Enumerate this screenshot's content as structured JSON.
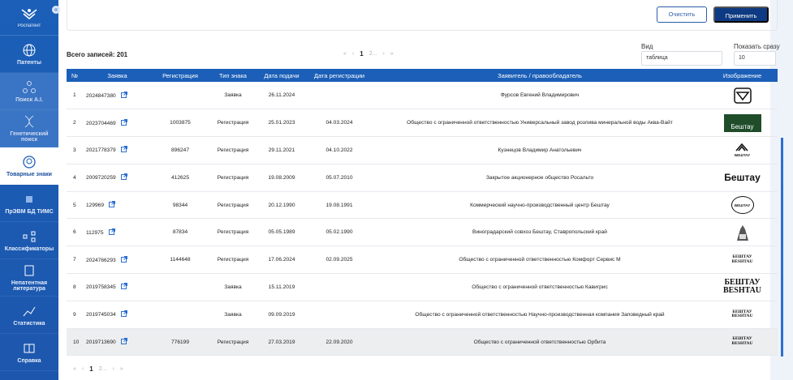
{
  "sidebar": {
    "logo_text": "Роспатент",
    "items": [
      {
        "label": "Патенты"
      },
      {
        "label": "Поиск А.I."
      },
      {
        "label": "Генетический поиск"
      },
      {
        "label": "Товарные знаки"
      },
      {
        "label": "ПрЭВМ БД ТИМС"
      },
      {
        "label": "Классификаторы"
      },
      {
        "label": "Непатентная литература"
      },
      {
        "label": "Статистика"
      },
      {
        "label": "Справка"
      }
    ]
  },
  "filter": {
    "clear_label": "Очистить",
    "apply_label": "Применить"
  },
  "results": {
    "total": "Всего записей: 201"
  },
  "pagination": {
    "prev_all": "«",
    "prev": "‹",
    "current": "1",
    "next_page": "2",
    "ellipsis": "...",
    "next": "›",
    "next_all": "»"
  },
  "view": {
    "label": "Вид",
    "value": "таблица"
  },
  "page_size": {
    "label": "Показать сразу",
    "value": "10"
  },
  "table": {
    "headers": [
      "№",
      "Заявка",
      "Регистрация",
      "Тип знака",
      "Дата подачи",
      "Дата регистрации",
      "Заявитель / правообладатель",
      "Изображение"
    ],
    "rows": [
      {
        "num": "1",
        "app": "2024847380",
        "reg": "",
        "type": "Заявка",
        "filed": "26.11.2024",
        "regdate": "",
        "owner": "Фурсов Евгений Владимирович",
        "mark": ""
      },
      {
        "num": "2",
        "app": "2023704469",
        "reg": "1003875",
        "type": "Регистрация",
        "filed": "25.01.2023",
        "regdate": "04.03.2024",
        "owner": "Общество с ограниченной ответственностью Универсальный завод розлива минеральной воды Аква-Вайт",
        "mark": "Бештау"
      },
      {
        "num": "3",
        "app": "2021778379",
        "reg": "896247",
        "type": "Регистрация",
        "filed": "29.11.2021",
        "regdate": "04.10.2022",
        "owner": "Кузнецов Владимир Анатольевич",
        "mark": "БЕШТАУ"
      },
      {
        "num": "4",
        "app": "2009720259",
        "reg": "412625",
        "type": "Регистрация",
        "filed": "19.08.2009",
        "regdate": "05.07.2010",
        "owner": "Закрытое акционерное общество Росальто",
        "mark": "Бештау"
      },
      {
        "num": "5",
        "app": "129969",
        "reg": "98344",
        "type": "Регистрация",
        "filed": "20.12.1990",
        "regdate": "19.08.1991",
        "owner": "Коммерческий научно-производственный центр Бештау",
        "mark": "БЕШТАУ"
      },
      {
        "num": "6",
        "app": "112975",
        "reg": "87834",
        "type": "Регистрация",
        "filed": "05.05.1989",
        "regdate": "05.02.1990",
        "owner": "Виноградарский совхоз Бештау, Ставропольский край",
        "mark": ""
      },
      {
        "num": "7",
        "app": "2024766293",
        "reg": "1144648",
        "type": "Регистрация",
        "filed": "17.06.2024",
        "regdate": "02.09.2025",
        "owner": "Общество с ограниченной ответственностью Комфорт Сервис М",
        "mark": "БЕШТАУ\nBESHTAU"
      },
      {
        "num": "8",
        "app": "2019758345",
        "reg": "",
        "type": "Заявка",
        "filed": "15.11.2019",
        "regdate": "",
        "owner": "Общество с ограниченной ответственностью Кавигрис",
        "mark": "БЕШТАУ\nBESHTAU"
      },
      {
        "num": "9",
        "app": "2019745034",
        "reg": "",
        "type": "Заявка",
        "filed": "09.09.2019",
        "regdate": "",
        "owner": "Общество с ограниченной ответственностью Научно-производственная компания Заповедный край",
        "mark": "БЕШТАУ\nBESHTAU"
      },
      {
        "num": "10",
        "app": "2019713690",
        "reg": "776199",
        "type": "Регистрация",
        "filed": "27.03.2019",
        "regdate": "22.09.2020",
        "owner": "Общество с ограниченной ответственностью Орбита",
        "mark": "БЕШТАУ\nBESHTAU"
      }
    ]
  },
  "colors": {
    "sidebar": "#1b5fb8",
    "header": "#1b5fb8",
    "apply": "#0d3a82"
  }
}
